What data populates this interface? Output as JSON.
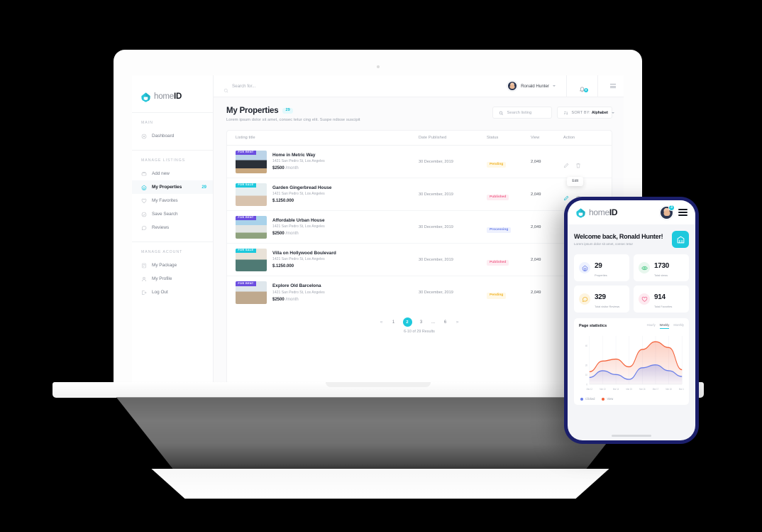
{
  "brand": {
    "name_light": "home",
    "name_bold": "ID",
    "logo_icon": "house-logo-icon"
  },
  "laptop": {
    "topbar": {
      "search_placeholder": "Search for...",
      "search_value": "",
      "search_icon": "search-icon",
      "user_name": "Ronald Hunter",
      "user_caret_icon": "chevron-down-icon",
      "avatar_icon": "avatar",
      "bell_icon": "bell-icon",
      "bell_badge": "0",
      "menu_icon": "hamburger-menu-icon"
    },
    "sidebar": {
      "groups": [
        {
          "title": "MAIN",
          "items": [
            {
              "label": "Dashboard",
              "icon": "dashboard-icon",
              "badge": "",
              "active": false
            }
          ]
        },
        {
          "title": "MANAGE LISTINGS",
          "items": [
            {
              "label": "Add new",
              "icon": "add-new-icon",
              "badge": "",
              "active": false
            },
            {
              "label": "My Properties",
              "icon": "properties-icon",
              "badge": "29",
              "active": true
            },
            {
              "label": "My Favorites",
              "icon": "heart-icon",
              "badge": "",
              "active": false
            },
            {
              "label": "Save Search",
              "icon": "save-search-icon",
              "badge": "",
              "active": false
            },
            {
              "label": "Reviews",
              "icon": "chat-bubble-icon",
              "badge": "",
              "active": false
            }
          ]
        },
        {
          "title": "MANAGE ACOUNT",
          "items": [
            {
              "label": "My Package",
              "icon": "package-icon",
              "badge": "",
              "active": false
            },
            {
              "label": "My Profile",
              "icon": "user-icon",
              "badge": "",
              "active": false
            },
            {
              "label": "Log Out",
              "icon": "logout-icon",
              "badge": "",
              "active": false
            }
          ]
        }
      ]
    },
    "page": {
      "title": "My Properties",
      "title_count": "29",
      "subtitle": "Lorem ipsum dolor sit amet, consec tetur cing elit. Suspe ndisse suscipit",
      "search_listing_placeholder": "Search listing",
      "search_listing_value": "",
      "sort_label": "SORT BY:",
      "sort_value": "Alphabet",
      "sort_icon": "sort-icon",
      "columns": [
        "Listing title",
        "Date Published",
        "Status",
        "View",
        "Action"
      ],
      "edit_tooltip": "Edit",
      "rows": [
        {
          "tag": "FOR RENT",
          "tag_type": "rent",
          "title": "Home in Metric Way",
          "address": "1421 San Pedro St, Los Angeles",
          "price": "$2500",
          "price_unit": "/month",
          "date": "30 December, 2019",
          "status": "Pending",
          "status_type": "pending",
          "view": "2,049",
          "edit_icon": "pencil-icon",
          "delete_icon": "trash-icon"
        },
        {
          "tag": "FOR SALE",
          "tag_type": "sale",
          "title": "Garden Gingerbread House",
          "address": "1421 San Pedro St, Los Angeles",
          "price": "$.1250.000",
          "price_unit": "",
          "date": "30 December, 2019",
          "status": "Published",
          "status_type": "published",
          "view": "2,049",
          "edit_icon": "pencil-icon",
          "delete_icon": "trash-icon"
        },
        {
          "tag": "FOR RENT",
          "tag_type": "rent",
          "title": "Affordable Urban House",
          "address": "1421 San Pedro St, Los Angeles",
          "price": "$2500",
          "price_unit": "/month",
          "date": "30 December, 2019",
          "status": "Processing",
          "status_type": "processing",
          "view": "2,049",
          "edit_icon": "pencil-icon",
          "delete_icon": "trash-icon"
        },
        {
          "tag": "FOR SALE",
          "tag_type": "sale",
          "title": "Villa on Hollywood Boulevard",
          "address": "1421 San Pedro St, Los Angeles",
          "price": "$.1250.000",
          "price_unit": "",
          "date": "30 December, 2019",
          "status": "Published",
          "status_type": "published",
          "view": "2,049",
          "edit_icon": "pencil-icon",
          "delete_icon": "trash-icon"
        },
        {
          "tag": "FOR RENT",
          "tag_type": "rent",
          "title": "Explore Old Barcelona",
          "address": "1421 San Pedro St, Los Angeles",
          "price": "$2500",
          "price_unit": "/month",
          "date": "30 December, 2019",
          "status": "Pending",
          "status_type": "pending",
          "view": "2,049",
          "edit_icon": "pencil-icon",
          "delete_icon": "trash-icon"
        }
      ],
      "pagination": {
        "prev_icon": "double-chevron-left-icon",
        "next_icon": "double-chevron-right-icon",
        "pages": [
          "1",
          "2",
          "3",
          "...",
          "6"
        ],
        "current": "2",
        "results_note": "6-10 of 29 Results"
      }
    }
  },
  "phone": {
    "topbar": {
      "avatar_badge": "3",
      "avatar_icon": "avatar",
      "menu_icon": "hamburger-menu-icon"
    },
    "welcome": {
      "title": "Welcome back, Ronald Hunter!",
      "subtitle": "Lorem ipsum dolor sit amet, consec tetur",
      "icon": "building-icon"
    },
    "stats": [
      {
        "value": "29",
        "label": "Properties",
        "icon": "home-icon",
        "icon_bg": "#eef2fe",
        "icon_color": "#6a7fe8"
      },
      {
        "value": "1730",
        "label": "Total views",
        "icon": "eye-icon",
        "icon_bg": "#e8f7ee",
        "icon_color": "#3cc47c"
      },
      {
        "value": "329",
        "label": "Total visitor Reviews",
        "icon": "chat-icon",
        "icon_bg": "#fdf4e0",
        "icon_color": "#f0b429"
      },
      {
        "value": "914",
        "label": "Total Favorites",
        "icon": "heart-icon",
        "icon_bg": "#fdeaf0",
        "icon_color": "#f2688f"
      }
    ],
    "chart_card": {
      "title": "Page statistics",
      "tabs": [
        "Hourly",
        "Weekly",
        "Monthly"
      ],
      "active_tab": "Weekly"
    }
  },
  "chart_data": {
    "type": "area",
    "title": "Page statistics",
    "xlabel": "",
    "ylabel": "",
    "x": [
      "Mar 12",
      "Mar 13",
      "Mar 14",
      "Mar 15",
      "Mar 16",
      "Mar 17",
      "Mar 18",
      "Mar 19"
    ],
    "ytick_labels": [
      "0",
      "10",
      "20",
      "40"
    ],
    "ylim": [
      0,
      50
    ],
    "grid": true,
    "legend_position": "bottom-left",
    "series": [
      {
        "name": "Clicked",
        "color": "#6a7fe8",
        "values": [
          7,
          14,
          10,
          5,
          17,
          20,
          14,
          8
        ]
      },
      {
        "name": "View",
        "color": "#f4623a",
        "values": [
          13,
          24,
          26,
          18,
          36,
          44,
          38,
          15
        ]
      }
    ]
  }
}
